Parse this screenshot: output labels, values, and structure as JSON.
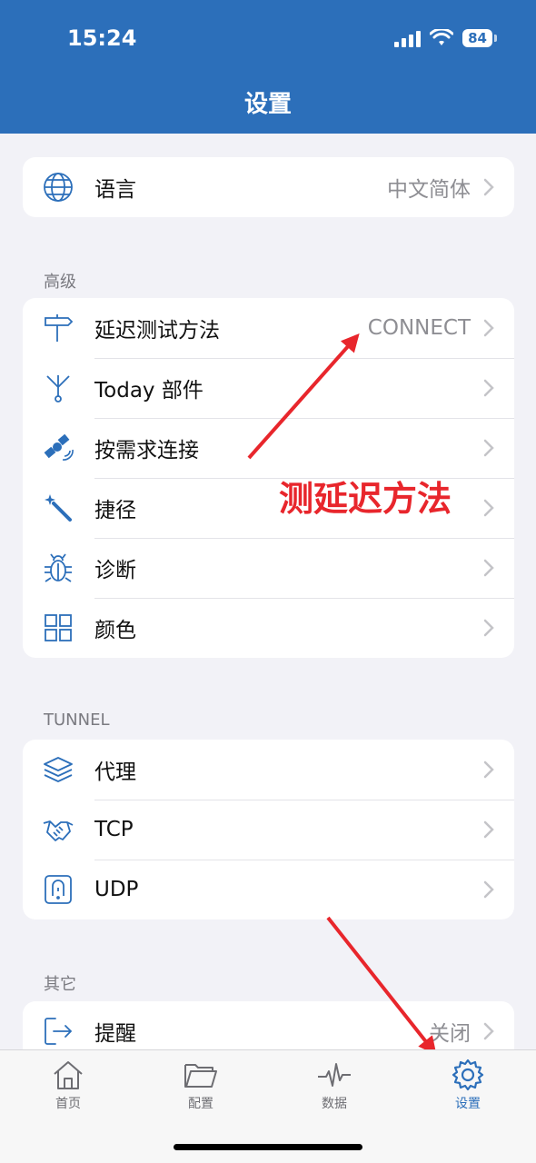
{
  "status": {
    "time": "15:24",
    "battery": "84"
  },
  "nav": {
    "title": "设置"
  },
  "group_language": {
    "rows": [
      {
        "label": "语言",
        "value": "中文简体",
        "icon": "globe-icon"
      }
    ]
  },
  "group_advanced": {
    "header": "高级",
    "rows": [
      {
        "label": "延迟测试方法",
        "value": "CONNECT",
        "icon": "signpost-icon"
      },
      {
        "label": "Today 部件",
        "value": "",
        "icon": "fork-icon"
      },
      {
        "label": "按需求连接",
        "value": "",
        "icon": "satellite-icon"
      },
      {
        "label": "捷径",
        "value": "",
        "icon": "magic-wand-icon"
      },
      {
        "label": "诊断",
        "value": "",
        "icon": "bug-icon"
      },
      {
        "label": "颜色",
        "value": "",
        "icon": "grid-icon"
      }
    ]
  },
  "group_tunnel": {
    "header": "TUNNEL",
    "rows": [
      {
        "label": "代理",
        "value": "",
        "icon": "layers-icon"
      },
      {
        "label": "TCP",
        "value": "",
        "icon": "handshake-icon"
      },
      {
        "label": "UDP",
        "value": "",
        "icon": "udp-icon"
      }
    ]
  },
  "group_other": {
    "header": "其它",
    "rows": [
      {
        "label": "提醒",
        "value": "关闭",
        "icon": "exit-icon"
      }
    ]
  },
  "annotation": {
    "text": "测延迟方法"
  },
  "tabs": [
    {
      "label": "首页",
      "icon": "home-icon",
      "active": false
    },
    {
      "label": "配置",
      "icon": "folder-icon",
      "active": false
    },
    {
      "label": "数据",
      "icon": "pulse-icon",
      "active": false
    },
    {
      "label": "设置",
      "icon": "gear-icon",
      "active": true
    }
  ],
  "colors": {
    "accent": "#2c6fba",
    "annotation": "#e8262c"
  }
}
